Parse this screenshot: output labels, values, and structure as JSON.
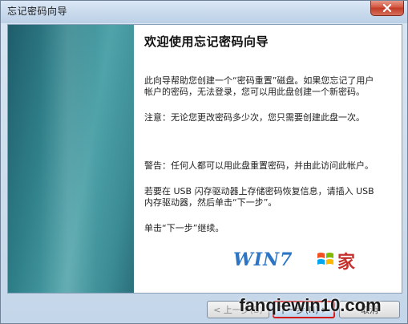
{
  "window": {
    "title": "忘记密码向导"
  },
  "content": {
    "heading": "欢迎使用忘记密码向导",
    "intro": "此向导帮助您创建一个“密码重置”磁盘。如果您忘记了用户帐户的密码，无法登录，您可以用此盘创建一个新密码。",
    "note": "注意：无论您更改密码多少次，您只需要创建此盘一次。",
    "warning": "警告：任何人都可以用此盘重置密码，并由此访问此帐户。",
    "usb": "若要在 USB 闪存驱动器上存储密码恢复信息，请插入 USB 内存驱动器，然后单击“下一步”。",
    "next_hint": "单击“下一步”继续。"
  },
  "buttons": {
    "back": "< 上一步(B)",
    "next": "下一步(N) >",
    "cancel": "取消"
  },
  "overlay": {
    "logo_text": "WIN7",
    "logo_suffix": "家",
    "watermark": "fanqiewin10.com"
  },
  "colors": {
    "banner": "#2f7f89",
    "highlight_border": "#d31b1b",
    "logo_blue": "#2d74c4"
  }
}
